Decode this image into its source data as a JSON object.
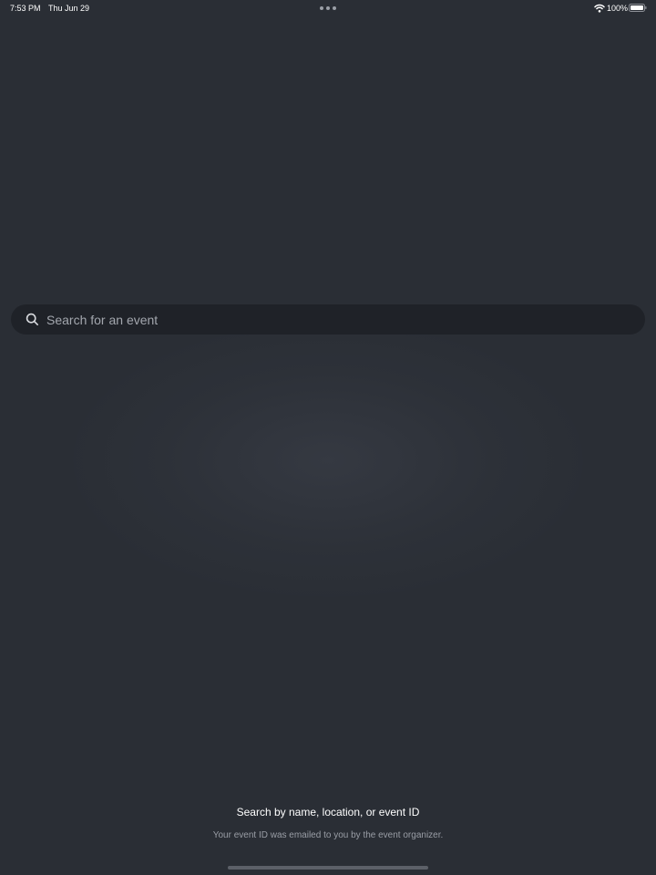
{
  "status_bar": {
    "time": "7:53 PM",
    "date": "Thu Jun 29",
    "battery": "100%",
    "icons": [
      "wifi-icon",
      "battery-icon"
    ]
  },
  "search": {
    "placeholder": "Search for an event",
    "value": "",
    "icon": "search-icon"
  },
  "help": {
    "title": "Search by name, location, or event ID",
    "subtitle": "Your event ID was emailed to you by the event organizer."
  },
  "colors": {
    "background": "#2a2e35",
    "search_bar": "#1f2228",
    "primary_text": "#ffffff",
    "secondary_text": "#9a9ea6"
  }
}
